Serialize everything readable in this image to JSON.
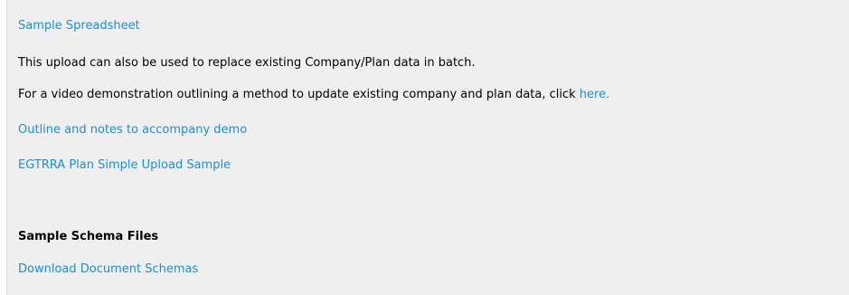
{
  "links": {
    "sample_spreadsheet": "Sample Spreadsheet",
    "outline_notes": "Outline and notes to accompany demo",
    "egtrra_sample": "EGTRRA Plan Simple Upload Sample",
    "download_schemas": "Download Document Schemas"
  },
  "text": {
    "replace_note": "This upload can also be used to replace existing Company/Plan data in batch.",
    "video_prefix": "For a video demonstration outlining a method to update existing company and plan data, click ",
    "video_link": "here."
  },
  "sections": {
    "schema_heading": "Sample Schema Files"
  },
  "colors": {
    "link": "#1f8dd6",
    "panel_background": "#efefef"
  }
}
